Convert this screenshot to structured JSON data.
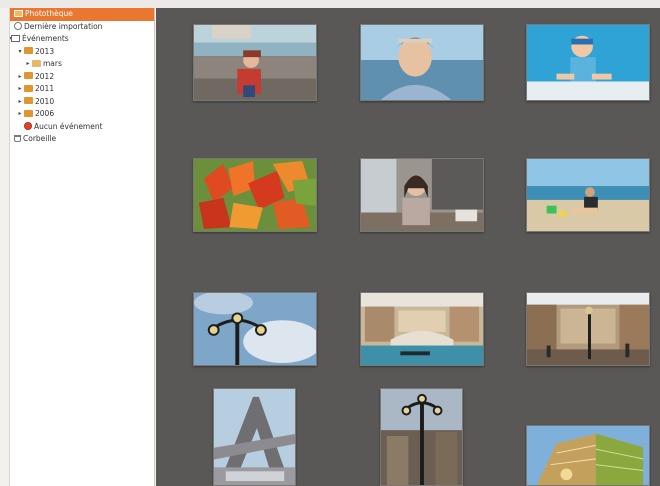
{
  "sidebar": {
    "items": [
      {
        "label": "Photothèque",
        "icon": "library-icon",
        "indent": 0,
        "expander": "",
        "selected": true
      },
      {
        "label": "Dernière importation",
        "icon": "clock-icon",
        "indent": 0,
        "expander": "",
        "selected": false
      },
      {
        "label": "Événements",
        "icon": "calendar-icon",
        "indent": 0,
        "expander": "▾",
        "selected": false
      },
      {
        "label": "2013",
        "icon": "folder-icon",
        "indent": 1,
        "expander": "▾",
        "selected": false
      },
      {
        "label": "mars",
        "icon": "folder-icon",
        "indent": 2,
        "expander": "▸",
        "selected": false
      },
      {
        "label": "2012",
        "icon": "folder-icon",
        "indent": 1,
        "expander": "▸",
        "selected": false
      },
      {
        "label": "2011",
        "icon": "folder-icon",
        "indent": 1,
        "expander": "▸",
        "selected": false
      },
      {
        "label": "2010",
        "icon": "folder-icon",
        "indent": 1,
        "expander": "▸",
        "selected": false
      },
      {
        "label": "2006",
        "icon": "folder-icon",
        "indent": 1,
        "expander": "▸",
        "selected": false
      },
      {
        "label": "Aucun événement",
        "icon": "no-event-icon",
        "indent": 1,
        "expander": "",
        "selected": false
      },
      {
        "label": "Corbeille",
        "icon": "trash-icon",
        "indent": 0,
        "expander": "",
        "selected": false
      }
    ]
  },
  "photos": [
    {
      "name": "girl-on-pebble-beach-photo"
    },
    {
      "name": "smiling-woman-sea-photo"
    },
    {
      "name": "child-in-pool-photo"
    },
    {
      "name": "autumn-leaves-photo"
    },
    {
      "name": "woman-indoors-photo"
    },
    {
      "name": "child-on-sand-beach-photo"
    },
    {
      "name": "street-lamp-sky-photo"
    },
    {
      "name": "venetian-canal-mall-photo"
    },
    {
      "name": "venetian-square-photo"
    },
    {
      "name": "eiffel-replica-photo"
    },
    {
      "name": "lamp-post-tower-photo"
    },
    {
      "name": "modern-building-photo"
    }
  ]
}
